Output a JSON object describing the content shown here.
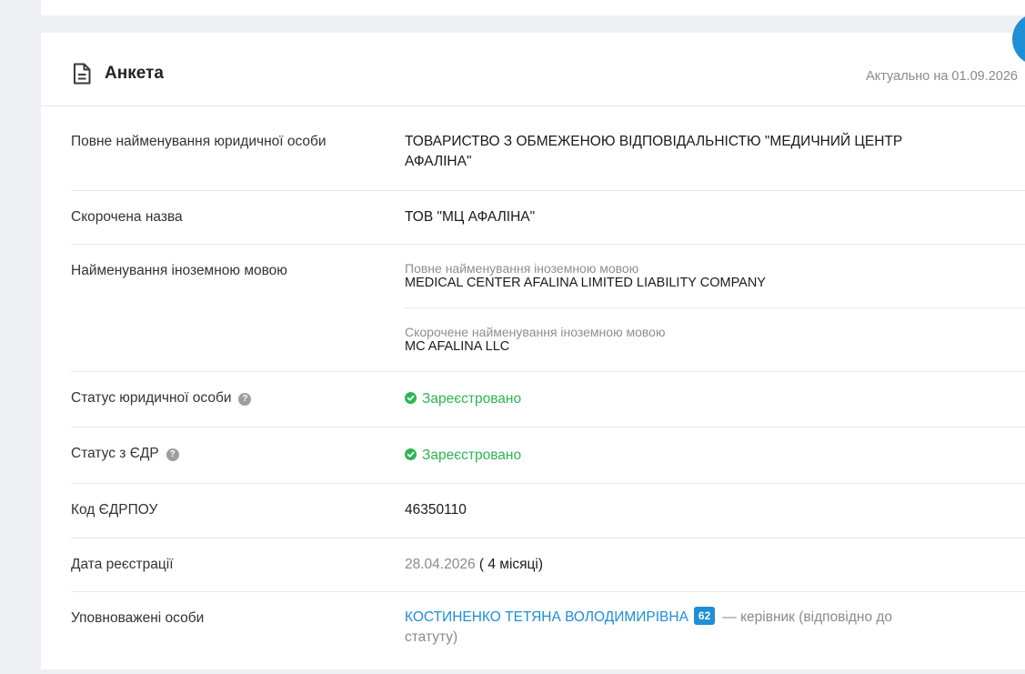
{
  "card": {
    "title": "Анкета",
    "actual_date": "Актуально на 01.09.2026"
  },
  "rows": {
    "full_name": {
      "label": "Повне найменування юридичної особи",
      "line1": "ТОВАРИСТВО З ОБМЕЖЕНОЮ ВІДПОВІДАЛЬНІСТЮ \"МЕДИЧНИЙ ЦЕНТР",
      "line2": "АФАЛІНА\""
    },
    "short_name": {
      "label": "Скорочена назва",
      "value": "ТОВ \"МЦ АФАЛІНА\""
    },
    "foreign": {
      "label": "Найменування іноземною мовою",
      "full_caption": "Повне найменування іноземною мовою",
      "full_value": "MEDICAL CENTER AFALINA LIMITED LIABILITY COMPANY",
      "short_caption": "Скорочене найменування іноземною мовою",
      "short_value": "MC AFALINA LLC"
    },
    "legal_status": {
      "label": "Статус юридичної особи",
      "help": "?",
      "value": "Зареєстровано"
    },
    "edr_status": {
      "label": "Статус з ЄДР",
      "help": "?",
      "value": "Зареєстровано"
    },
    "edrpou": {
      "label": "Код ЄДРПОУ",
      "value": "46350110"
    },
    "reg_date": {
      "label": "Дата реєстрації",
      "date": "28.04.2026",
      "age": "( 4 місяці)"
    },
    "authorized": {
      "label": "Уповноважені особи",
      "person": "КОСТИНЕНКО ТЕТЯНА ВОЛОДИМИРІВНА",
      "badge": "62",
      "role_line1": "— керівник (відповідно до",
      "role_line2": "статуту)"
    }
  },
  "colors": {
    "accent": "#1e8fd4",
    "status_green": "#2db553",
    "background": "#eef0f3"
  },
  "icons": {
    "header": "document-icon",
    "status": "check-circle-icon",
    "help": "question-circle-icon"
  }
}
